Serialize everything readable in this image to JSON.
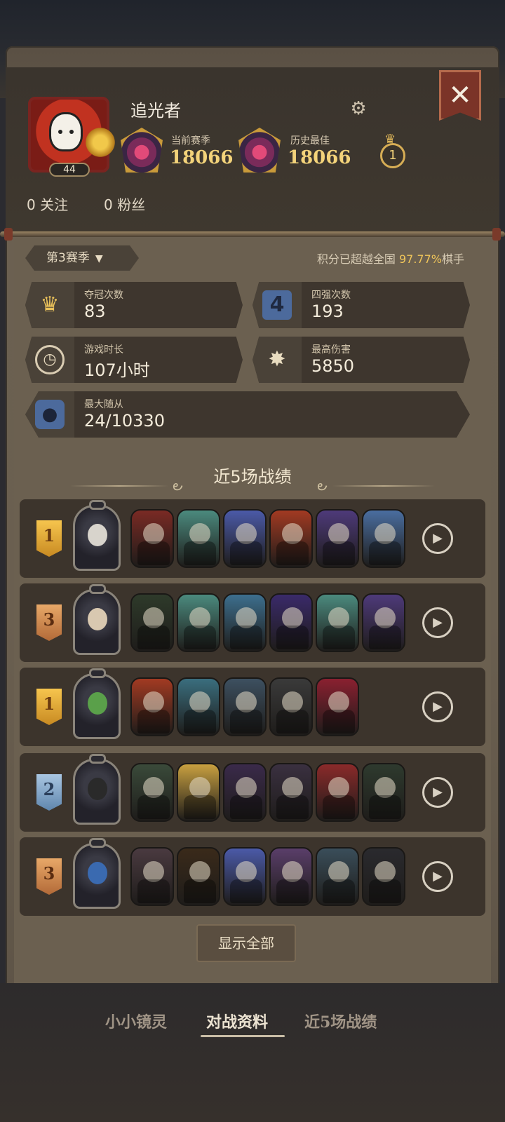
{
  "profile": {
    "name": "追光者",
    "level": "44",
    "current_season_label": "当前赛季",
    "current_season_score": "18066",
    "history_best_label": "历史最佳",
    "history_best_score": "18066",
    "rank_number": "1",
    "following": "0 关注",
    "followers": "0 粉丝"
  },
  "season": {
    "selected": "第3赛季",
    "rank_text_prefix": "积分已超越全国 ",
    "rank_percent": "97.77%",
    "rank_text_suffix": "棋手"
  },
  "stats": {
    "championships": {
      "label": "夺冠次数",
      "value": "83",
      "icon": "crown-icon"
    },
    "top4": {
      "label": "四强次数",
      "value": "193",
      "icon": "four-badge-icon"
    },
    "playtime": {
      "label": "游戏时长",
      "value": "107小时",
      "icon": "clock-icon"
    },
    "max_damage": {
      "label": "最高伤害",
      "value": "5850",
      "icon": "burst-icon"
    },
    "max_minions": {
      "label": "最大随从",
      "value": "24/10330",
      "icon": "minion-icon"
    }
  },
  "recent": {
    "title": "近5场战绩",
    "matches": [
      {
        "place": "1",
        "tier": "gold",
        "units": 6
      },
      {
        "place": "3",
        "tier": "bronze",
        "units": 6
      },
      {
        "place": "1",
        "tier": "gold",
        "units": 5
      },
      {
        "place": "2",
        "tier": "silver",
        "units": 6
      },
      {
        "place": "3",
        "tier": "bronze",
        "units": 6
      }
    ],
    "show_all": "显示全部"
  },
  "tabs": [
    "小小镜灵",
    "对战资料",
    "近5场战绩"
  ],
  "colors": {
    "gold_text": "#f3d37a",
    "panel": "#6b6050",
    "card": "#3e362e"
  }
}
